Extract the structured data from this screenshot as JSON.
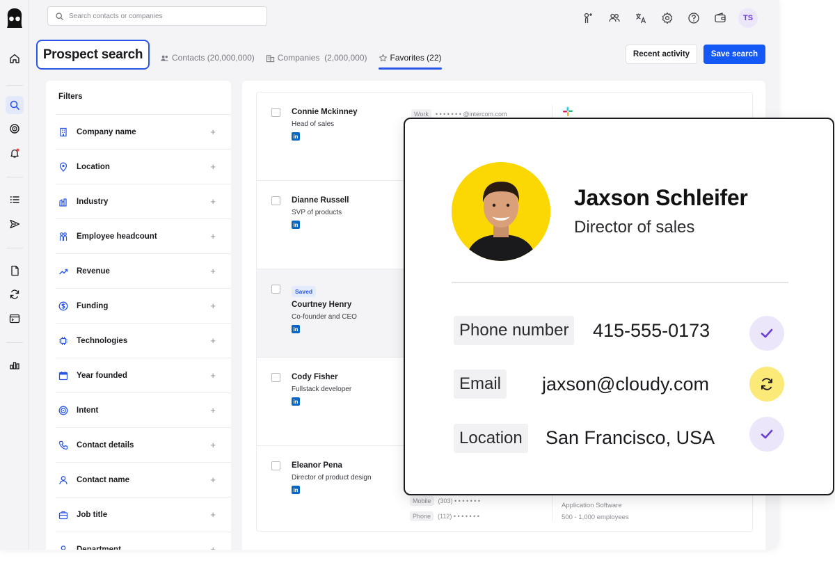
{
  "search": {
    "placeholder": "Search contacts or companies"
  },
  "user": {
    "initials": "TS"
  },
  "header": {
    "title": "Prospect search",
    "tabs": [
      {
        "label": "Contacts (20,000,000)",
        "icon": "people-icon"
      },
      {
        "label": "Companies  (2,000,000)",
        "icon": "building-icon"
      },
      {
        "label": "Favorites (22)",
        "icon": "star-icon"
      }
    ],
    "recent_label": "Recent activity",
    "save_label": "Save search"
  },
  "filters": {
    "title": "Filters",
    "items": [
      {
        "label": "Company name",
        "icon": "building-icon"
      },
      {
        "label": "Location",
        "icon": "location-pin-icon"
      },
      {
        "label": "Industry",
        "icon": "industry-icon"
      },
      {
        "label": "Employee headcount",
        "icon": "headcount-icon"
      },
      {
        "label": "Revenue",
        "icon": "trending-up-icon"
      },
      {
        "label": "Funding",
        "icon": "dollar-icon"
      },
      {
        "label": "Technologies",
        "icon": "chip-icon"
      },
      {
        "label": "Year founded",
        "icon": "calendar-icon"
      },
      {
        "label": "Intent",
        "icon": "target-icon"
      },
      {
        "label": "Contact details",
        "icon": "phone-icon"
      },
      {
        "label": "Contact name",
        "icon": "person-icon"
      },
      {
        "label": "Job title",
        "icon": "briefcase-icon"
      },
      {
        "label": "Department",
        "icon": "person-icon"
      }
    ],
    "plus": "+"
  },
  "results": {
    "saved_badge": "Saved",
    "linkedin": "in",
    "rows": [
      {
        "name": "Connie Mckinney",
        "title": "Head of sales",
        "saved": false
      },
      {
        "name": "Dianne Russell",
        "title": "SVP of products",
        "saved": false
      },
      {
        "name": "Courtney Henry",
        "title": "Co-founder and CEO",
        "saved": true
      },
      {
        "name": "Cody Fisher",
        "title": "Fullstack developer",
        "saved": false
      },
      {
        "name": "Eleanor Pena",
        "title": "Director of product design",
        "saved": false
      }
    ],
    "first_row_work_tag": "Work",
    "first_row_work_value": "• • • • • • • @intercom.com",
    "last_row": {
      "mobile_tag": "Mobile",
      "mobile_value": "(303) • • • • • • •",
      "phone_tag": "Phone",
      "phone_value": "(112) • • • • • • •",
      "industry": "Application Software",
      "employees": "500 - 1,000 employees"
    }
  },
  "card": {
    "name": "Jaxson Schleifer",
    "role": "Director of sales",
    "fields": [
      {
        "label": "Phone number",
        "value": "415-555-0173",
        "status": "verified"
      },
      {
        "label": "Email",
        "value": "jaxson@cloudy.com",
        "status": "syncing"
      },
      {
        "label": "Location",
        "value": "San Francisco, USA",
        "status": "verified"
      }
    ]
  },
  "colors": {
    "accent": "#1459f5",
    "highlight_border": "#2a56e8",
    "verified_bg": "#ece6fb",
    "verified_check": "#6b3fd1",
    "sync_bg": "#fbe978",
    "photo_bg": "#fbd704",
    "linkedin": "#0a66c2"
  }
}
